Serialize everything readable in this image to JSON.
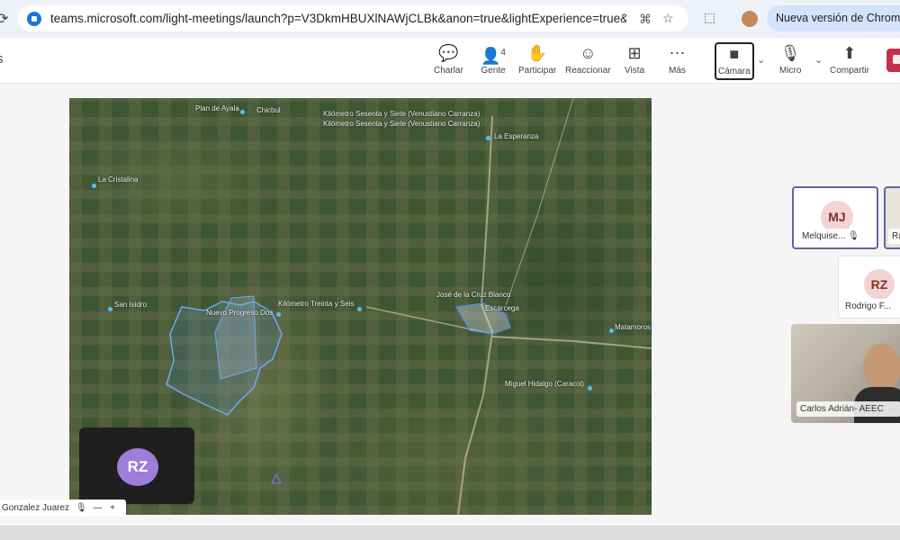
{
  "browser": {
    "url": "teams.microsoft.com/light-meetings/launch?p=V3DkmHBUXlNAWjCLBk&anon=true&lightExperience=true&corre...",
    "update_label": "Nueva versión de Chrome d"
  },
  "toolbar": {
    "chat": "Charlar",
    "people": "Gente",
    "people_count": "4",
    "raise": "Participar",
    "react": "Reaccionar",
    "view": "Vista",
    "more": "Más",
    "camera": "Cámara",
    "mic": "Micro",
    "share": "Compartir"
  },
  "map": {
    "labels": {
      "plan_de_ayala": "Plan de Ayala",
      "chichul": "Chicbul",
      "km67_a": "Kilómetro Sesenta y Siete (Venustiano Carranza)",
      "km67_b": "Kilómetro Sesenta y Siete (Venustiano Carranza)",
      "la_esperanza": "La Esperanza",
      "la_cristalina": "La Cristalina",
      "san_isidro": "San Isidro",
      "nuevo_progreso": "Nuevo Progreso Dos",
      "km36": "Kilómetro Treinta y Seis",
      "jose_cruz": "José de la Cruz Blanco",
      "escarcega": "Escárcega",
      "matamoros": "Matamoros",
      "miguel_hidalgo": "Miguel Hidalgo (Caracol)"
    }
  },
  "participants": {
    "mj": {
      "initials": "MJ",
      "name": "Melquise..."
    },
    "r_partial": {
      "name": "Ra"
    },
    "rf": {
      "initials": "RZ",
      "name": "Rodrigo F..."
    },
    "carlos": {
      "name": "Carlos Adrián- AEEC"
    },
    "self": {
      "initials": "RZ",
      "name": "Gonzalez Juarez"
    }
  },
  "colors": {
    "accent": "#6264a7",
    "hangup": "#c4314b",
    "avatar_pink": "#f3d3d0",
    "avatar_purple": "#9e7ed9"
  }
}
